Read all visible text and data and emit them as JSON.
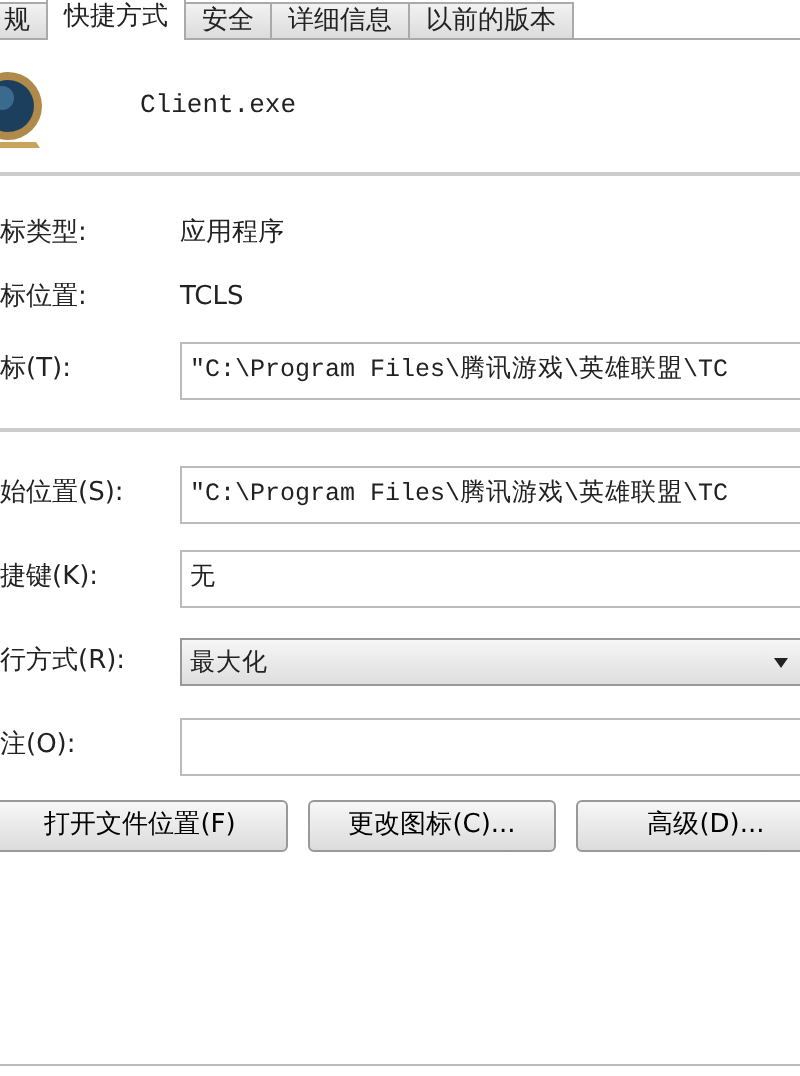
{
  "tabs": [
    {
      "label": "规",
      "selected": false
    },
    {
      "label": "快捷方式",
      "selected": true
    },
    {
      "label": "安全",
      "selected": false
    },
    {
      "label": "详细信息",
      "selected": false
    },
    {
      "label": "以前的版本",
      "selected": false
    }
  ],
  "file_name": "Client.exe",
  "info_rows": [
    {
      "label": "标类型:",
      "value": "应用程序"
    },
    {
      "label": "标位置:",
      "value": "TCLS"
    }
  ],
  "target": {
    "label": "标(T):",
    "value": "\"C:\\Program Files\\腾讯游戏\\英雄联盟\\TC"
  },
  "fields": [
    {
      "kind": "text",
      "label": "始位置(S):",
      "value": "\"C:\\Program Files\\腾讯游戏\\英雄联盟\\TC"
    },
    {
      "kind": "text",
      "label": "捷键(K):",
      "value": "无"
    },
    {
      "kind": "select",
      "label": "行方式(R):",
      "value": "最大化"
    },
    {
      "kind": "text",
      "label": "注(O):"
    }
  ],
  "buttons": [
    "打开文件位置(F)",
    "更改图标(C)...",
    "高级(D)..."
  ]
}
